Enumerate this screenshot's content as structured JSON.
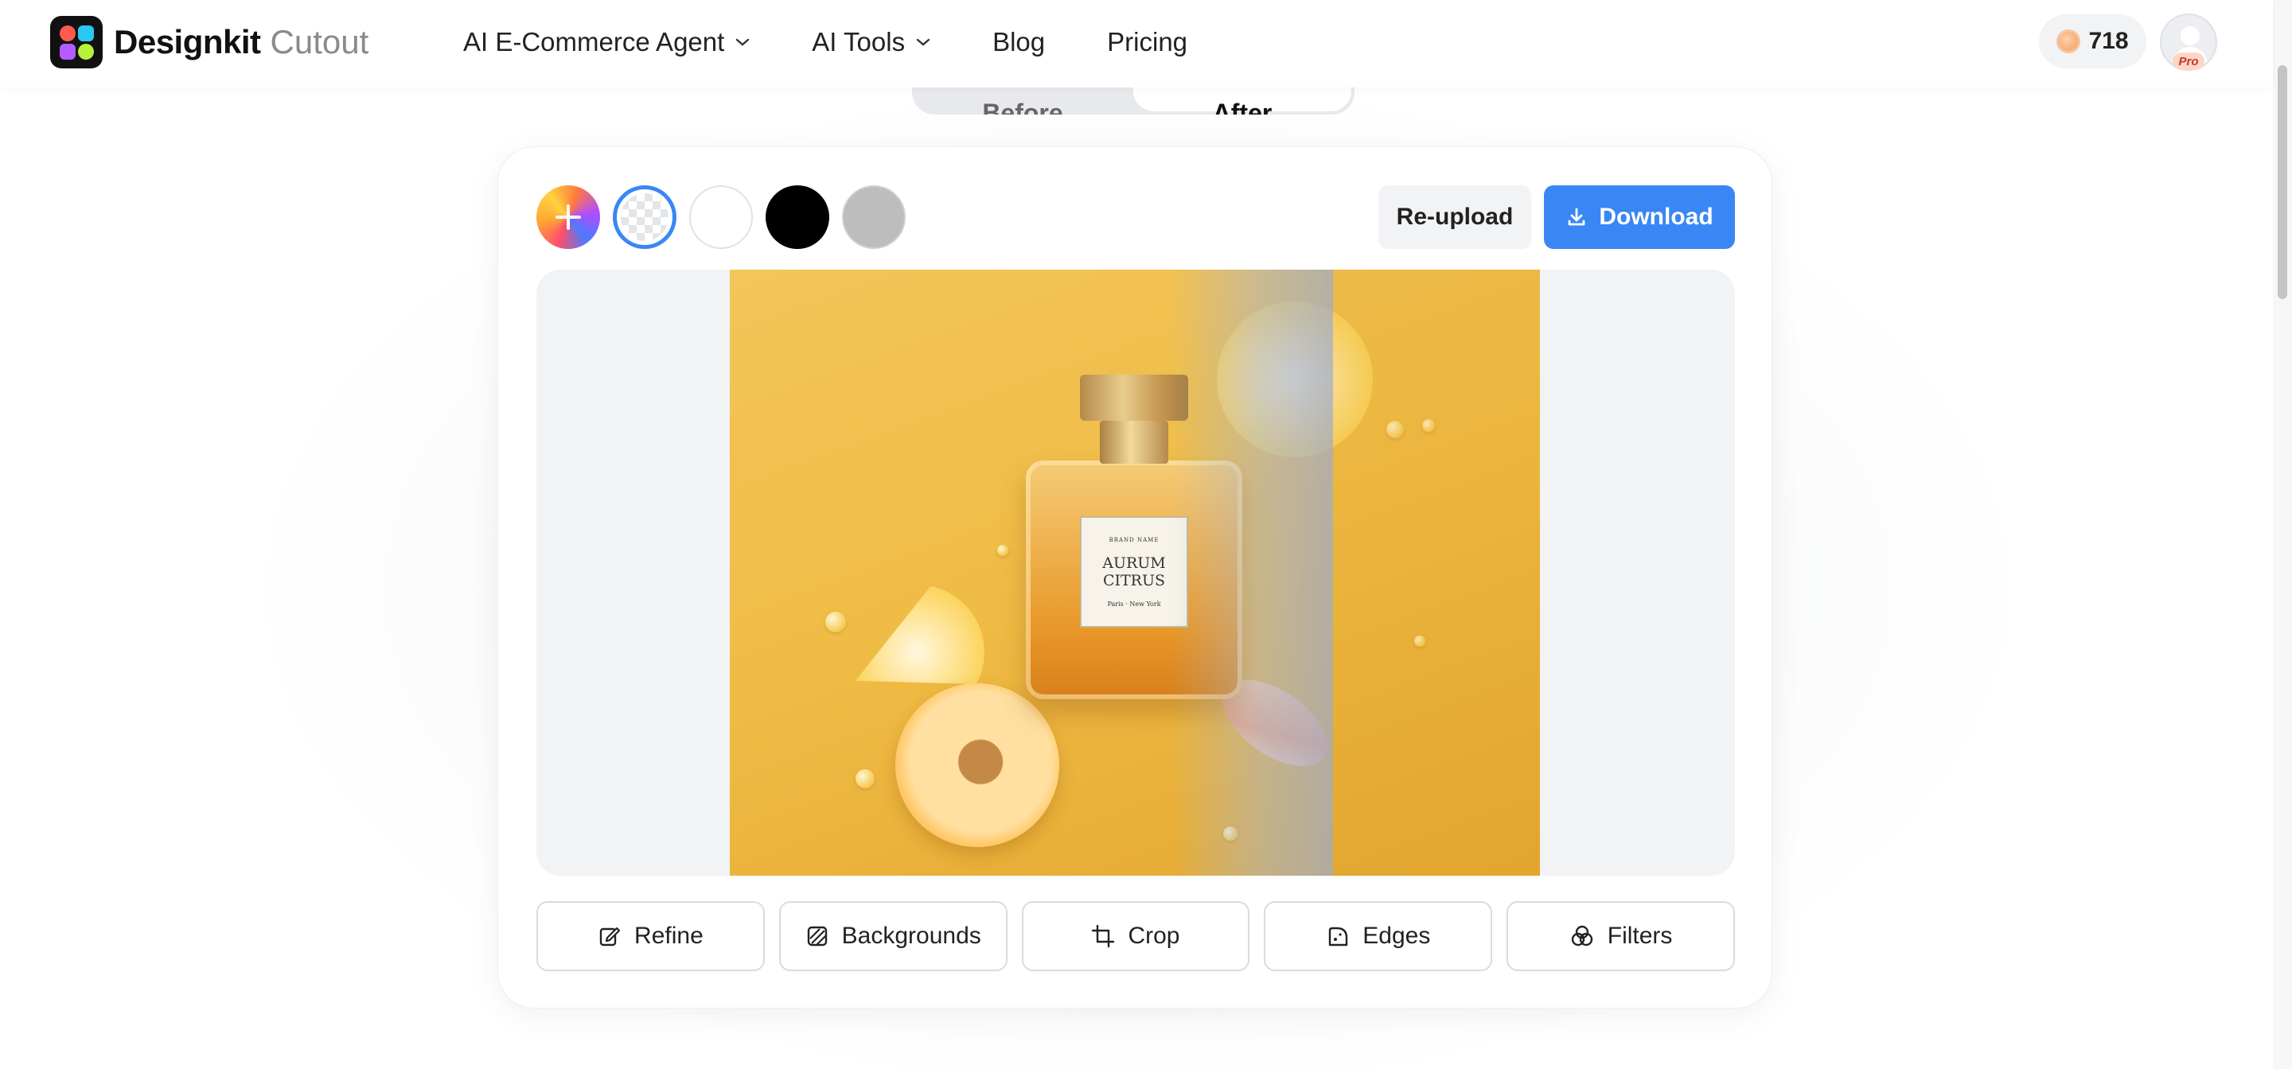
{
  "header": {
    "logo_name": "Designkit",
    "logo_sub": "Cutout",
    "nav": [
      {
        "label": "AI E-Commerce Agent",
        "has_dropdown": true
      },
      {
        "label": "AI Tools",
        "has_dropdown": true
      },
      {
        "label": "Blog",
        "has_dropdown": false
      },
      {
        "label": "Pricing",
        "has_dropdown": false
      }
    ],
    "credits": "718",
    "avatar_badge": "Pro"
  },
  "toggle": {
    "before": "Before",
    "after": "After",
    "selected": "After"
  },
  "editor": {
    "swatches": [
      {
        "name": "add-color",
        "color": "gradient"
      },
      {
        "name": "transparent",
        "color": "transparent",
        "selected": true
      },
      {
        "name": "white",
        "color": "#ffffff"
      },
      {
        "name": "black",
        "color": "#000000"
      },
      {
        "name": "gray",
        "color": "#bdbdbd"
      }
    ],
    "reupload_label": "Re-upload",
    "download_label": "Download",
    "image_label": {
      "brand": "BRAND NAME",
      "name_line1": "AURUM",
      "name_line2": "CITRUS",
      "origin": "Paris · New York"
    },
    "tools": [
      {
        "label": "Refine",
        "icon": "edit-icon"
      },
      {
        "label": "Backgrounds",
        "icon": "backgrounds-icon"
      },
      {
        "label": "Crop",
        "icon": "crop-icon"
      },
      {
        "label": "Edges",
        "icon": "edges-icon"
      },
      {
        "label": "Filters",
        "icon": "filters-icon"
      }
    ]
  },
  "colors": {
    "accent": "#3a86f5",
    "canvas_bg": "#f2f3f5"
  }
}
